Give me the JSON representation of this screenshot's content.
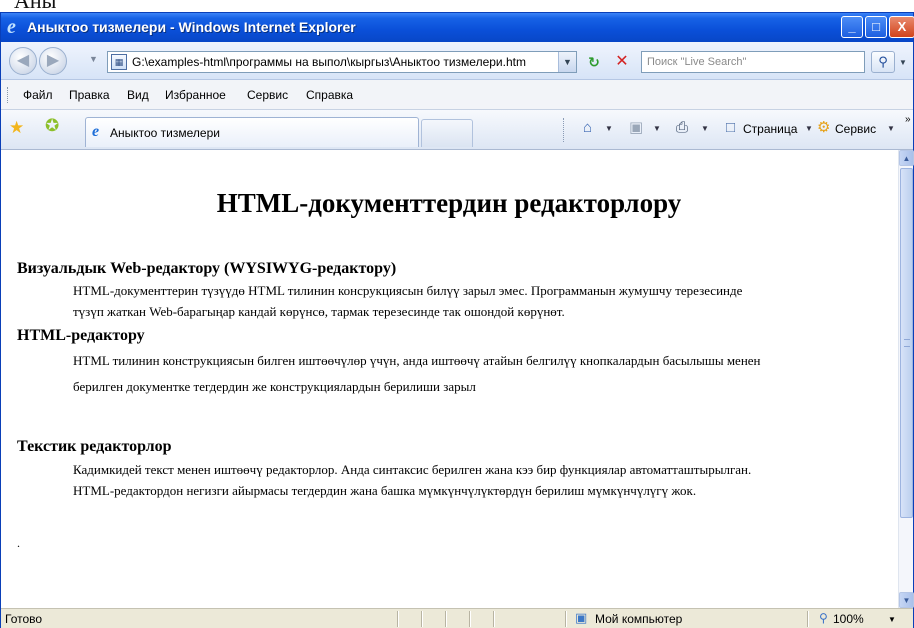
{
  "window": {
    "title": "Аныктоо тизмелери - Windows Internet Explorer",
    "buttons": {
      "minimize": "_",
      "maximize": "□",
      "close": "X"
    }
  },
  "address": {
    "url": "G:\\examples-html\\программы на выпол\\кыргыз\\Аныктоо тизмелери.htm",
    "search_placeholder": "Поиск \"Live Search\""
  },
  "menu": {
    "items": [
      "Файл",
      "Правка",
      "Вид",
      "Избранное",
      "Сервис",
      "Справка"
    ]
  },
  "tabs": {
    "active_label": "Аныктоо тизмелери",
    "page_label": "Страница",
    "tools_label": "Сервис"
  },
  "document": {
    "title": "HTML-документтердин редакторлору",
    "items": [
      {
        "term": "Визуальдык Web-редактору (WYSIWYG-редактору)",
        "lines": [
          "HTML-документтерин түзүүдө HTML тилинин консрукциясын билүү зарыл эмес. Программанын жумушчу терезесинде",
          "түзүп жаткан Web-барагыңар кандай көрүнсө, тармак терезесинде так ошондой көрүнөт."
        ]
      },
      {
        "term": "HTML-редактору",
        "lines": [
          "HTML тилинин конструкциясын билген иштөөчүлөр үчүн, анда иштөөчү атайын белгилүү кнопкалардын басылышы менен",
          "берилген документке тегдердин же конструкциялардын берилиши зарыл"
        ]
      },
      {
        "term": "Текстик редакторлор",
        "lines": [
          "Кадимкидей текст менен иштөөчү редакторлор. Анда синтаксис берилген жана кээ бир функциялар автоматташтырылган.",
          "HTML-редактордон негизги айырмасы тегдердин жана башка мүмкүнчүлүктөрдүн берилиш мүмкүнчүлүгү жок."
        ]
      }
    ],
    "footer_dot": "."
  },
  "status": {
    "text": "Готово",
    "zone": "Мой компьютер",
    "zoom": "100%"
  }
}
